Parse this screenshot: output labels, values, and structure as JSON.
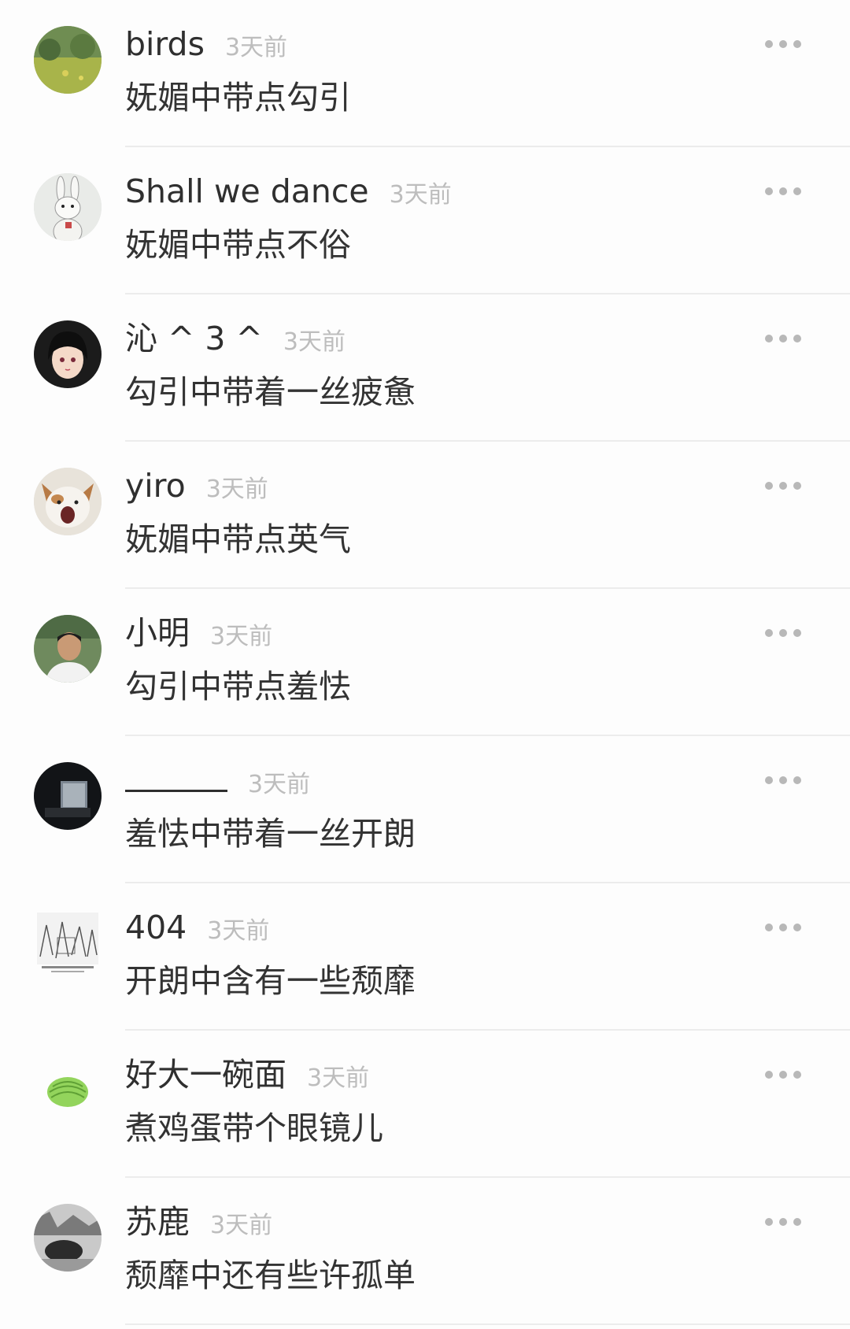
{
  "comments": [
    {
      "username": "birds",
      "time": "3天前",
      "text": "妩媚中带点勾引",
      "avatar": "meadow-photo-avatar"
    },
    {
      "username": "Shall we dance",
      "time": "3天前",
      "text": "妩媚中带点不俗",
      "avatar": "rabbit-illustration-avatar"
    },
    {
      "username": "沁 ^ 3 ^",
      "time": "3天前",
      "text": "勾引中带着一丝疲惫",
      "avatar": "anime-girl-avatar"
    },
    {
      "username": "yiro",
      "time": "3天前",
      "text": "妩媚中带点英气",
      "avatar": "screaming-cat-avatar"
    },
    {
      "username": "小明",
      "time": "3天前",
      "text": "勾引中带点羞怯",
      "avatar": "boy-photo-avatar"
    },
    {
      "username": "",
      "time": "3天前",
      "text": "羞怯中带着一丝开朗",
      "avatar": "dark-window-avatar"
    },
    {
      "username": "404",
      "time": "3天前",
      "text": "开朗中含有一些颓靡",
      "avatar": "comic-sketch-avatar"
    },
    {
      "username": "好大一碗面",
      "time": "3天前",
      "text": "煮鸡蛋带个眼镜儿",
      "avatar": "green-melon-avatar"
    },
    {
      "username": "苏鹿",
      "time": "3天前",
      "text": "颓靡中还有些许孤单",
      "avatar": "monochrome-photo-avatar"
    }
  ],
  "more_icon": "more-dots-icon",
  "colors": {
    "username": "#2f2f2f",
    "time": "#bdbdbd",
    "content": "#333333",
    "divider": "#ececec",
    "background": "#fdfdfd"
  }
}
